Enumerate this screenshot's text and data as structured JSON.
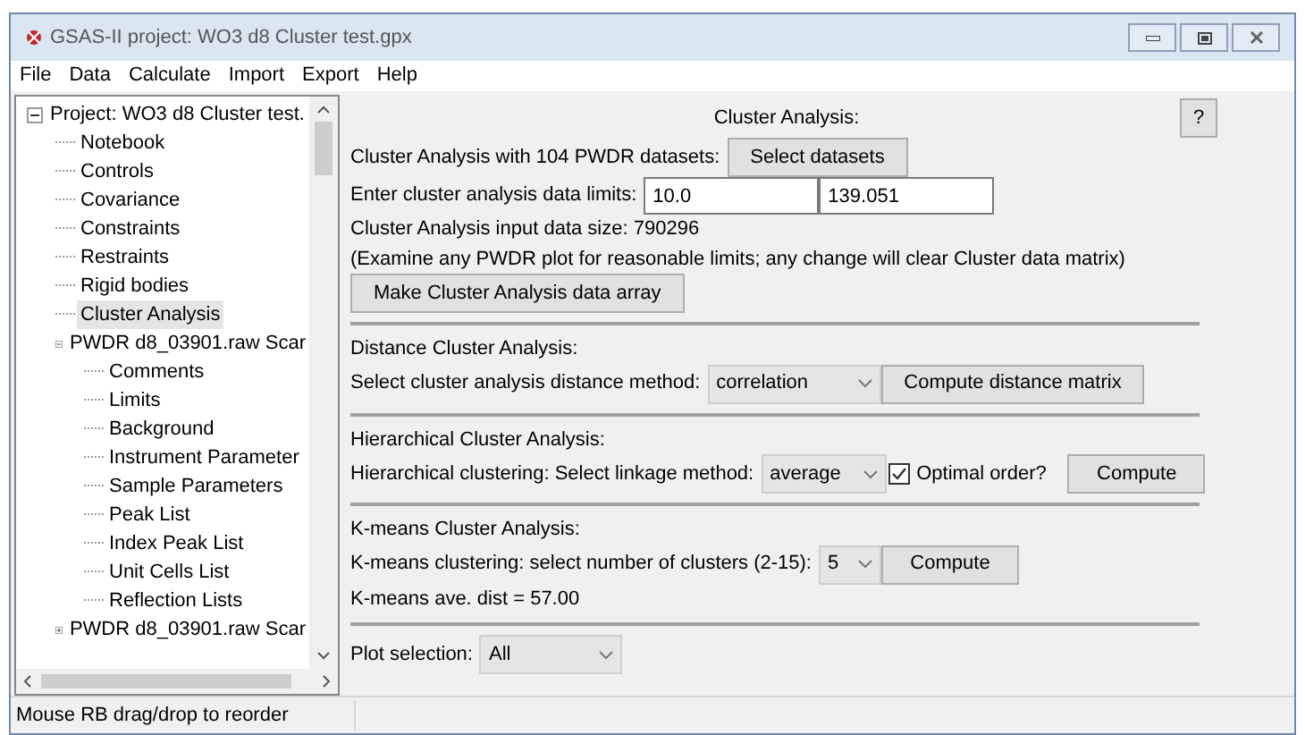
{
  "window": {
    "title": "GSAS-II project: WO3 d8 Cluster test.gpx"
  },
  "menu": [
    "File",
    "Data",
    "Calculate",
    "Import",
    "Export",
    "Help"
  ],
  "tree": [
    {
      "label": "Project: WO3 d8 Cluster test.",
      "expanded": true,
      "selected": false,
      "children": [
        {
          "label": "Notebook",
          "selected": false
        },
        {
          "label": "Controls",
          "selected": false
        },
        {
          "label": "Covariance",
          "selected": false
        },
        {
          "label": "Constraints",
          "selected": false
        },
        {
          "label": "Restraints",
          "selected": false
        },
        {
          "label": "Rigid bodies",
          "selected": false
        },
        {
          "label": "Cluster Analysis",
          "selected": true
        },
        {
          "label": "PWDR d8_03901.raw Scar",
          "expanded": true,
          "selected": false,
          "children": [
            {
              "label": "Comments",
              "selected": false
            },
            {
              "label": "Limits",
              "selected": false
            },
            {
              "label": "Background",
              "selected": false
            },
            {
              "label": "Instrument Parameter",
              "selected": false
            },
            {
              "label": "Sample Parameters",
              "selected": false
            },
            {
              "label": "Peak List",
              "selected": false
            },
            {
              "label": "Index Peak List",
              "selected": false
            },
            {
              "label": "Unit Cells List",
              "selected": false
            },
            {
              "label": "Reflection Lists",
              "selected": false
            }
          ]
        },
        {
          "label": "PWDR d8_03901.raw Scar",
          "expanded": false,
          "selected": false
        }
      ]
    }
  ],
  "panel": {
    "title": "Cluster Analysis:",
    "help_button": "?",
    "datasets_label": "Cluster Analysis with 104 PWDR datasets:",
    "datasets_button": "Select datasets",
    "limits_label": "Enter cluster analysis data limits:",
    "limit_low": "10.0",
    "limit_high": "139.051",
    "size_text": "Cluster Analysis input data size: 790296",
    "note": "(Examine any PWDR plot for reasonable limits; any change will clear Cluster data matrix)",
    "make_button": "Make Cluster Analysis data array",
    "distance": {
      "heading": "Distance Cluster Analysis:",
      "label": "Select cluster analysis distance method:",
      "method": "correlation",
      "button": "Compute distance matrix"
    },
    "hierarchical": {
      "heading": "Hierarchical Cluster Analysis:",
      "label": "Hierarchical clustering: Select linkage method:",
      "method": "average",
      "optimal_label": "Optimal order?",
      "optimal_checked": true,
      "button": "Compute"
    },
    "kmeans": {
      "heading": "K-means Cluster Analysis:",
      "label": "K-means clustering: select number of clusters (2-15):",
      "clusters": "5",
      "button": "Compute",
      "result": "K-means ave. dist = 57.00"
    },
    "plot_label": "Plot selection:",
    "plot_value": "All"
  },
  "status_bar": "Mouse RB drag/drop to reorder"
}
